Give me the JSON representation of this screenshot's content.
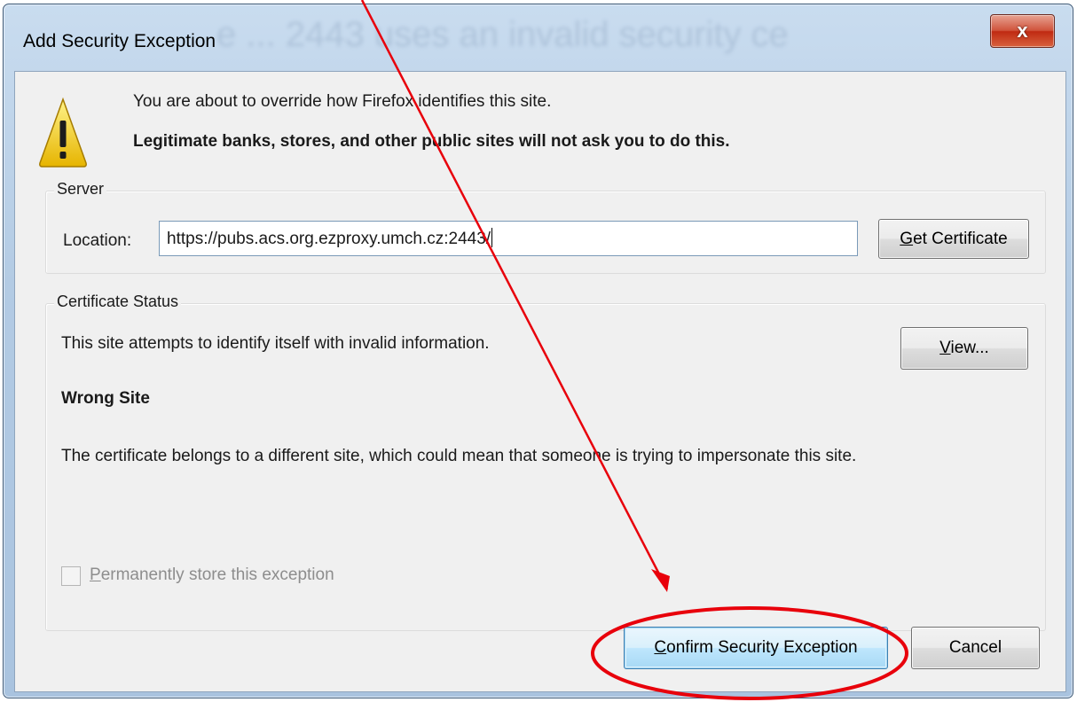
{
  "window": {
    "title": "Add Security Exception",
    "close_glyph": "x"
  },
  "intro": {
    "line1": "You are about to override how Firefox identifies this site.",
    "line2": "Legitimate banks, stores, and other public sites will not ask you to do this.",
    "icon": "warning-icon"
  },
  "server": {
    "legend": "Server",
    "location_label": "Location:",
    "location_value": "https://pubs.acs.org.ezproxy.umch.cz:2443/",
    "get_certificate_label": "Get Certificate",
    "get_certificate_access": "G"
  },
  "status": {
    "legend": "Certificate Status",
    "message": "This site attempts to identify itself with invalid information.",
    "view_label": "View...",
    "view_access": "V",
    "error_title": "Wrong Site",
    "error_description": "The certificate belongs to a different site, which could mean that someone is trying to impersonate this site."
  },
  "permanent": {
    "label": "Permanently store this exception",
    "access": "P",
    "checked": false,
    "disabled": true
  },
  "footer": {
    "confirm_label": "Confirm Security Exception",
    "confirm_access": "C",
    "cancel_label": "Cancel"
  },
  "colors": {
    "annotation": "#e8000b",
    "titlebar": "#b3cbe4",
    "client_bg": "#f0f0f0",
    "close_button": "#c94a30"
  }
}
